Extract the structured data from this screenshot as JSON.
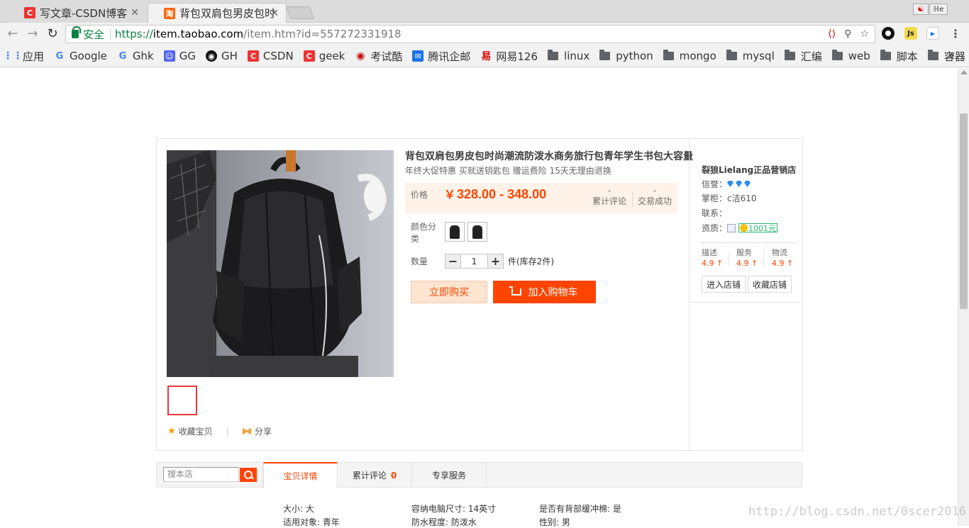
{
  "browser": {
    "tabs": [
      {
        "title": "写文章-CSDN博客",
        "favicon": "C"
      },
      {
        "title": "背包双肩包男皮包时",
        "favicon": "淘"
      }
    ],
    "window_badge": "ℍe",
    "url": {
      "secure_label": "安全",
      "scheme": "https://",
      "host": "item.taobao.com",
      "path": "/item.htm?id=557272331918"
    },
    "extensions": [
      "Js"
    ],
    "bookmarks": [
      {
        "label": "应用",
        "icon": "apps-grid-icon",
        "color": "#4285f4"
      },
      {
        "label": "Google",
        "icon": "google-icon",
        "color": "#4285f4"
      },
      {
        "label": "Ghk",
        "icon": "google-icon",
        "color": "#4285f4"
      },
      {
        "label": "GG",
        "icon": "discord-icon",
        "color": "#5865f2"
      },
      {
        "label": "GH",
        "icon": "github-icon",
        "color": "#111111"
      },
      {
        "label": "CSDN",
        "icon": "csdn-icon",
        "color": "#e33"
      },
      {
        "label": "geek",
        "icon": "csdn-icon",
        "color": "#e33"
      },
      {
        "label": "考试酷",
        "icon": "eye-icon",
        "color": "#c00"
      },
      {
        "label": "腾讯企邮",
        "icon": "tencent-mail-icon",
        "color": "#1a73e8"
      },
      {
        "label": "网易126",
        "icon": "netease-icon",
        "color": "#d00"
      },
      {
        "label": "linux",
        "icon": "folder-icon"
      },
      {
        "label": "python",
        "icon": "folder-icon"
      },
      {
        "label": "mongo",
        "icon": "folder-icon"
      },
      {
        "label": "mysql",
        "icon": "folder-icon"
      },
      {
        "label": "汇编",
        "icon": "folder-icon"
      },
      {
        "label": "web",
        "icon": "folder-icon"
      },
      {
        "label": "脚本",
        "icon": "folder-icon"
      },
      {
        "label": "容器",
        "icon": "folder-icon"
      }
    ],
    "more": "»"
  },
  "product": {
    "title": "背包双肩包男皮包时尚潮流防泼水商务旅行包青年学生书包大容量",
    "subtitle": "年终大促特惠 买就送钥匙包 赠运费险 15天无理由退换",
    "price_label": "价格",
    "price_symbol": "￥",
    "price": "328.00 - 348.00",
    "stats": [
      {
        "value": "-",
        "label": "累计评论"
      },
      {
        "value": "-",
        "label": "交易成功"
      }
    ],
    "color_label": "颜色分类",
    "quantity_label": "数量",
    "quantity": "1",
    "minus": "−",
    "plus": "+",
    "stock": "件(库存2件)",
    "buy_now": "立即购买",
    "add_to_cart": "加入购物车",
    "favorite": "收藏宝贝",
    "share": "分享"
  },
  "shop": {
    "name": "裂狼Lielang正品营销店",
    "reputation_label": "信誉：",
    "reputation_diamonds": 3,
    "keeper_label": "掌柜：",
    "keeper": "c洁610",
    "contact_label": "联系：",
    "qualification_label": "资质：",
    "deposit": "1001元",
    "ratings": [
      {
        "label": "描述",
        "value": "4.9"
      },
      {
        "label": "服务",
        "value": "4.9"
      },
      {
        "label": "物流",
        "value": "4.9"
      }
    ],
    "enter_shop": "进入店铺",
    "favorite_shop": "收藏店铺"
  },
  "detail": {
    "search_placeholder": "搜本店",
    "tabs": [
      {
        "label": "宝贝详情",
        "count": ""
      },
      {
        "label": "累计评论",
        "count": "0"
      },
      {
        "label": "专享服务",
        "count": ""
      }
    ],
    "attributes": [
      "大小: 大",
      "容纳电脑尺寸: 14英寸",
      "是否有背部缓冲棉: 是",
      "适用对象: 青年",
      "防水程度: 防泼水",
      "性别: 男"
    ]
  },
  "watermark": "http://blog.csdn.net/0scer2016"
}
